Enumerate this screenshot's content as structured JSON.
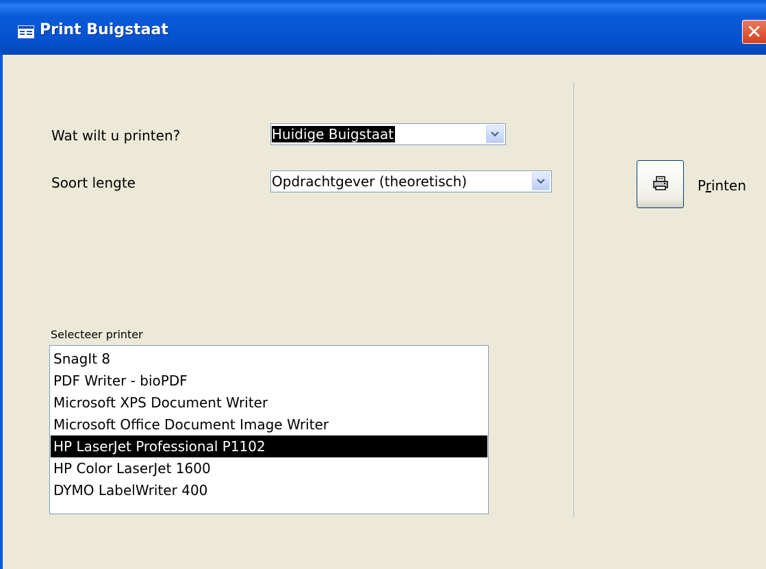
{
  "window": {
    "title": "Print Buigstaat",
    "close_glyph": "✕"
  },
  "form": {
    "what_label": "Wat wilt u printen?",
    "what_value": "Huidige Buigstaat",
    "length_label": "Soort lengte",
    "length_value": "Opdrachtgever (theoretisch)",
    "printer_label": "Selecteer printer",
    "printers": [
      "SnagIt 8",
      "PDF Writer - bioPDF",
      "Microsoft XPS Document Writer",
      "Microsoft Office Document Image Writer",
      "HP LaserJet Professional P1102",
      "HP Color LaserJet 1600",
      "DYMO LabelWriter 400"
    ],
    "selected_printer_index": 4
  },
  "actions": {
    "print_label_pre": "P",
    "print_label_accel": "r",
    "print_label_post": "inten",
    "print_icon": "printer-icon"
  },
  "colors": {
    "titlebar": "#0a5ad8",
    "dialog_bg": "#ece9d8",
    "selection_bg": "#000000",
    "close_button": "#d6411d"
  }
}
